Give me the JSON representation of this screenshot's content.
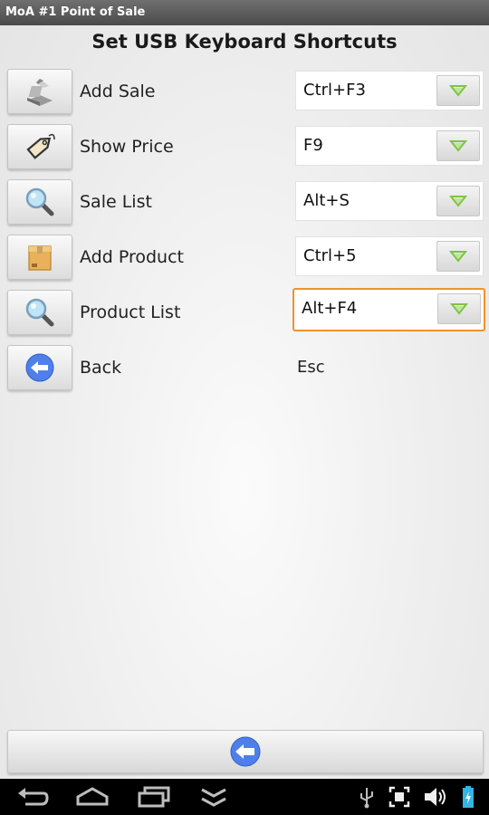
{
  "app": {
    "title": "MoA #1 Point of Sale"
  },
  "page": {
    "title": "Set USB Keyboard Shortcuts"
  },
  "shortcuts": [
    {
      "label": "Add Sale",
      "value": "Ctrl+F3",
      "icon": "cash-register-icon"
    },
    {
      "label": "Show Price",
      "value": "F9",
      "icon": "price-tag-icon"
    },
    {
      "label": "Sale List",
      "value": "Alt+S",
      "icon": "magnifier-icon"
    },
    {
      "label": "Add Product",
      "value": "Ctrl+5",
      "icon": "product-box-icon"
    },
    {
      "label": "Product List",
      "value": "Alt+F4",
      "icon": "magnifier-icon",
      "focused": true
    }
  ],
  "back": {
    "label": "Back",
    "value": "Esc",
    "icon": "back-arrow-icon"
  },
  "colors": {
    "accent": "#f0922b",
    "arrow": "#7dc443",
    "backCircle": "#4f7fe8"
  },
  "navbar": {
    "icons": [
      "nav-back-icon",
      "nav-home-icon",
      "nav-recents-icon",
      "nav-menu-icon",
      "usb-icon",
      "screenshot-icon",
      "volume-icon",
      "battery-icon"
    ]
  }
}
